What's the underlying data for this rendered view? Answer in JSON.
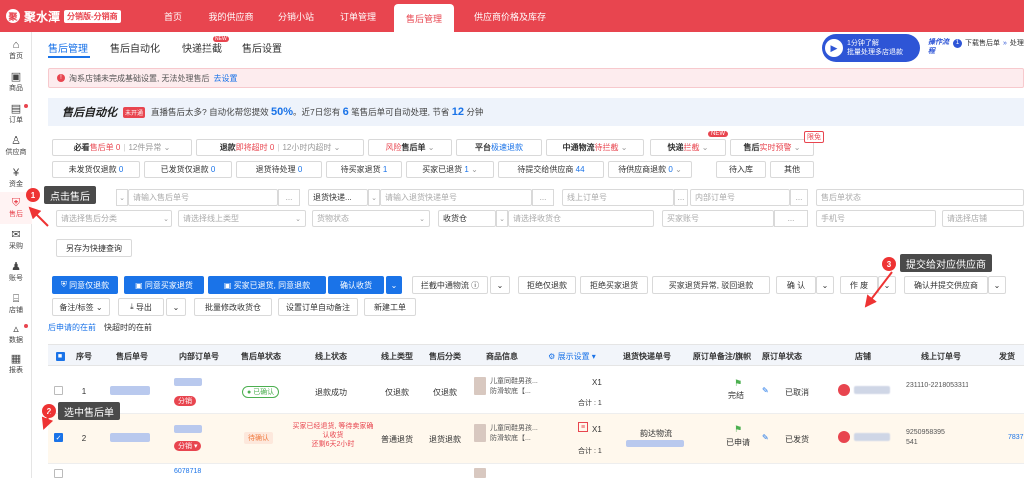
{
  "app": {
    "brand": "聚水潭",
    "edition": "分销版-分销商"
  },
  "topnav": [
    "首页",
    "我的供应商",
    "分销小站",
    "订单管理",
    "售后管理",
    "供应商价格及库存"
  ],
  "sidebar": [
    "首页",
    "商品",
    "订单",
    "供应商",
    "资金",
    "售后",
    "采购",
    "账号",
    "店铺",
    "数据",
    "报表"
  ],
  "subtabs": {
    "items": [
      "售后管理",
      "售后自动化",
      "快递拦截",
      "售后设置"
    ],
    "new_badge": "NEW"
  },
  "promo": {
    "line1": "1分钟了解",
    "line2": "批量处理多店退款",
    "flow_label": "操作流程",
    "step1_num": "1",
    "step1": "下载售后单",
    "step2_arrow": "»",
    "step2": "处理"
  },
  "warning": {
    "text": "淘系店铺未完成基础设置, 无法处理售后",
    "link": "去设置"
  },
  "automation": {
    "title": "售后自动化",
    "tag": "未开通",
    "msg1": "直播售后太多? 自动化帮您提效",
    "pct": "50%",
    "msg2": "。近7日您有",
    "count": "6",
    "msg3": "笔售后单可自动处理, 节省",
    "minutes": "12",
    "msg4": "分钟"
  },
  "filters_row1": {
    "must_see": "必看",
    "aftersale_label": "售后单",
    "aftersale_count": "0",
    "abnormal": "12件异常",
    "refund": "退款",
    "refund_red": "即将超时",
    "refund_count": "0",
    "within12": "12小时内超时",
    "risk_red": "风险",
    "risk_label": "售后单",
    "platform": "平台",
    "platform_blue": "极速退款",
    "zt": "中通物流",
    "zt_red": "待拦截",
    "express": "快递",
    "express_red": "拦截",
    "warn_label": "售后",
    "warn_red": "实时预警",
    "new_badge": "NEW",
    "limited": "限免"
  },
  "filters_row2": [
    {
      "label": "未发货仅退款",
      "count": "0"
    },
    {
      "label": "已发货仅退款",
      "count": "0"
    },
    {
      "label": "退货待处理",
      "count": "0"
    },
    {
      "label": "待买家退货",
      "count": "1"
    },
    {
      "label": "买家已退货",
      "count": "1"
    },
    {
      "label": "待提交给供应商",
      "count": "44"
    },
    {
      "label": "待供应商退款",
      "count": "0"
    },
    {
      "label": "待入库",
      "count": ""
    },
    {
      "label": "其他",
      "count": ""
    }
  ],
  "search": {
    "aftersale_no_ph": "请输入售后单号",
    "return_express": "退货快递...",
    "return_express_ph": "请输入退货快递单号",
    "online_order_ph": "线上订单号",
    "internal_order_ph": "内部订单号",
    "status_ph": "售后单状态",
    "category_ph": "请选择售后分类",
    "online_type_ph": "请选择线上类型",
    "goods_status_ph": "货物状态",
    "receiving_wh": "收货仓",
    "receiving_wh_ph": "请选择收货仓",
    "buyer_ph": "买家账号",
    "phone_ph": "手机号",
    "shop_ph": "请选择店铺",
    "ellipsis": "...",
    "save_quick": "另存为快捷查询"
  },
  "actions_row1": [
    "同意仅退款",
    "同意买家退货",
    "买家已退货, 同意退款",
    "确认收货",
    "拦截中通物流",
    "拒绝仅退款",
    "拒绝买家退货",
    "买家退货异常, 驳回退款",
    "确 认",
    "作 废",
    "确认并提交供应商"
  ],
  "actions_row2": [
    "备注/标签",
    "导出",
    "批量修改收货仓",
    "设置订单自动备注",
    "新建工单"
  ],
  "sort": {
    "a": "后申请的在前",
    "b": "快超时的在前"
  },
  "table": {
    "columns": [
      "序号",
      "售后单号",
      "内部订单号",
      "售后单状态",
      "线上状态",
      "线上类型",
      "售后分类",
      "商品信息",
      "展示设置",
      "退货快递单号",
      "原订单备注/旗帜",
      "原订单状态",
      "店铺",
      "线上订单号",
      "发货"
    ],
    "rows": [
      {
        "seq": "1",
        "status": "已确认",
        "online_status": "退款成功",
        "online_type": "仅退款",
        "category": "仅退款",
        "product": "儿童同鞋男孩...",
        "product2": "防滑软底【...",
        "qty": "X1",
        "total": "合计 : 1",
        "remark": "完结",
        "order_status": "已取消",
        "order_no": "231110-22180533110067",
        "order_no2": "067",
        "split_tag": "分销"
      },
      {
        "seq": "2",
        "status": "待确认",
        "online_status": "买家已经退货, 等待卖家确认收货",
        "timer": "还剩6天2小时",
        "online_type": "普通退货",
        "category": "退货退款",
        "product": "儿童同鞋男孩...",
        "product2": "防滑软底【...",
        "qty": "X1",
        "total": "合计 : 1",
        "express": "韵达物流",
        "remark": "已申请",
        "order_status": "已发货",
        "order_no": "9250958395",
        "order_no2": "541",
        "internal_no": "6078718",
        "split_tag": "分销",
        "ship": "7837"
      }
    ]
  },
  "annotations": {
    "a1_num": "1",
    "a1": "点击售后",
    "a2_num": "2",
    "a2": "选中售后单",
    "a3_num": "3",
    "a3": "提交给对应供应商"
  }
}
